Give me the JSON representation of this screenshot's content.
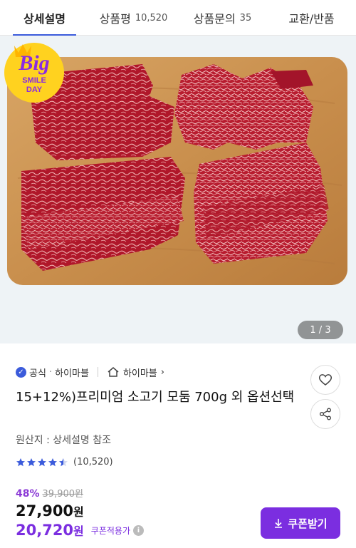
{
  "tabs": [
    {
      "label": "상세설명",
      "count": "",
      "active": true
    },
    {
      "label": "상품평",
      "count": "10,520",
      "active": false
    },
    {
      "label": "상품문의",
      "count": "35",
      "active": false
    },
    {
      "label": "교환/반품",
      "count": "",
      "active": false
    }
  ],
  "hero": {
    "badge": {
      "line1": "Big",
      "line2": "SMILE",
      "line3": "DAY"
    },
    "page_indicator": "1 / 3"
  },
  "seller": {
    "verified_label": "공식",
    "name": "하이마블",
    "store_link": "하이마블"
  },
  "product": {
    "title": "15+12%)프리미엄 소고기 모둠 700g 외 옵션선택",
    "origin": "원산지 : 상세설명 참조",
    "rating_count": "(10,520)",
    "rating_value": 4.5
  },
  "price": {
    "discount": "48%",
    "original": "39,900원",
    "sale": "27,900",
    "sale_unit": "원",
    "coupon_price": "20,720",
    "coupon_unit": "원",
    "coupon_label": "쿠폰적용가",
    "coupon_button": "쿠폰받기"
  },
  "colors": {
    "accent": "#7b2ee0",
    "tab_indicator": "#3b5bdb",
    "star": "#3b5bdb"
  }
}
